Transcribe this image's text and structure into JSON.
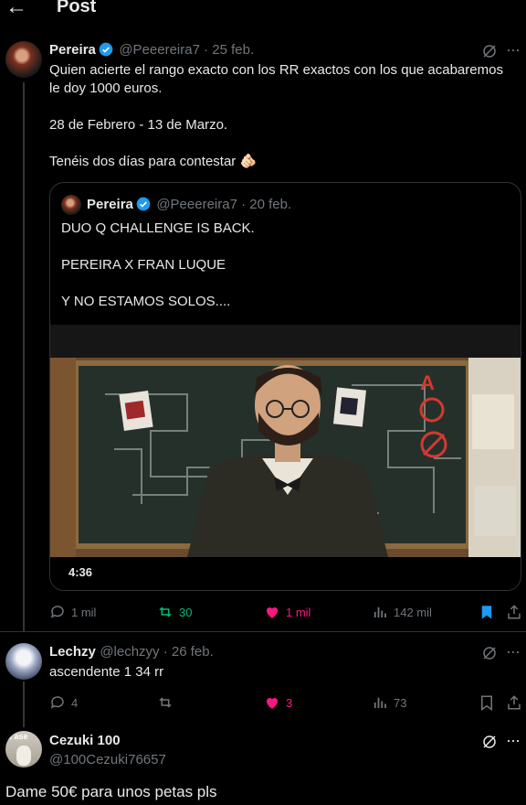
{
  "header": {
    "back_glyph": "←",
    "title": "Post"
  },
  "main_post": {
    "name": "Pereira",
    "handle_date": "@Peeereira7 · 25 feb.",
    "text": "Quien acierte el rango exacto con los RR exactos con los que acabaremos\nle doy 1000 euros.\n\n28 de Febrero - 13 de Marzo.\n\nTenéis dos días para contestar 🫵🏻",
    "quote": {
      "name": "Pereira",
      "handle_date": "@Peeereira7 · 20 feb.",
      "text": "DUO Q CHALLENGE IS BACK.\n\nPEREIRA X FRAN LUQUE\n\nY NO ESTAMOS SOLOS....",
      "video_duration": "4:36"
    },
    "actions": {
      "replies": "1 mil",
      "reposts": "30",
      "likes": "1 mil",
      "views": "142 mil"
    }
  },
  "reply1": {
    "name": "Lechzy",
    "handle_date": "@lechzyy · 26 feb.",
    "text": "ascendente 1 34 rr",
    "actions": {
      "replies": "4",
      "reposts": "",
      "likes": "3",
      "views": "73"
    }
  },
  "reply2": {
    "name": "Cezuki 100",
    "handle": "@100Cezuki76657",
    "avatar_text": "k ase",
    "text": "Dame 50€ para unos petas pls"
  },
  "colors": {
    "blue": "#1d9bf0",
    "green": "#00ba7c",
    "pink": "#f91880",
    "muted": "#71767b"
  }
}
